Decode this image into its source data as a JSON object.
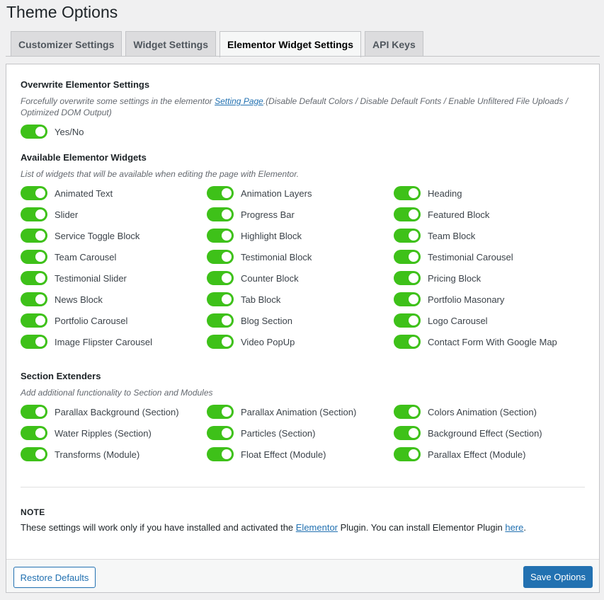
{
  "page_title": "Theme Options",
  "tabs": [
    {
      "label": "Customizer Settings",
      "active": false
    },
    {
      "label": "Widget Settings",
      "active": false
    },
    {
      "label": "Elementor Widget Settings",
      "active": true
    },
    {
      "label": "API Keys",
      "active": false
    }
  ],
  "overwrite": {
    "title": "Overwrite Elementor Settings",
    "desc_before": "Forcefully overwrite some settings in the elementor ",
    "desc_link": "Setting Page",
    "desc_after": ".(Disable Default Colors / Disable Default Fonts / Enable Unfiltered File Uploads / Optimized DOM Output)",
    "toggle_label": "Yes/No",
    "enabled": true
  },
  "widgets": {
    "title": "Available Elementor Widgets",
    "desc": "List of widgets that will be available when editing the page with Elementor.",
    "items": [
      "Animated Text",
      "Animation Layers",
      "Heading",
      "Slider",
      "Progress Bar",
      "Featured Block",
      "Service Toggle Block",
      "Highlight Block",
      "Team Block",
      "Team Carousel",
      "Testimonial Block",
      "Testimonial Carousel",
      "Testimonial Slider",
      "Counter Block",
      "Pricing Block",
      "News Block",
      "Tab Block",
      "Portfolio Masonary",
      "Portfolio Carousel",
      "Blog Section",
      "Logo Carousel",
      "Image Flipster Carousel",
      "Video PopUp",
      "Contact Form With Google Map"
    ]
  },
  "extenders": {
    "title": "Section Extenders",
    "desc": "Add additional functionality to Section and Modules",
    "items": [
      "Parallax Background (Section)",
      "Parallax Animation (Section)",
      "Colors Animation (Section)",
      "Water Ripples (Section)",
      "Particles (Section)",
      "Background Effect (Section)",
      "Transforms (Module)",
      "Float Effect (Module)",
      "Parallax Effect (Module)"
    ]
  },
  "note": {
    "title": "NOTE",
    "text_before": "These settings will work only if you have installed and activated the ",
    "link1": "Elementor",
    "text_middle": " Plugin. You can install Elementor Plugin ",
    "link2": "here",
    "text_after": "."
  },
  "buttons": {
    "restore": "Restore Defaults",
    "save": "Save Options"
  },
  "colors": {
    "toggle_on": "#3ec119",
    "primary": "#2271b1"
  }
}
